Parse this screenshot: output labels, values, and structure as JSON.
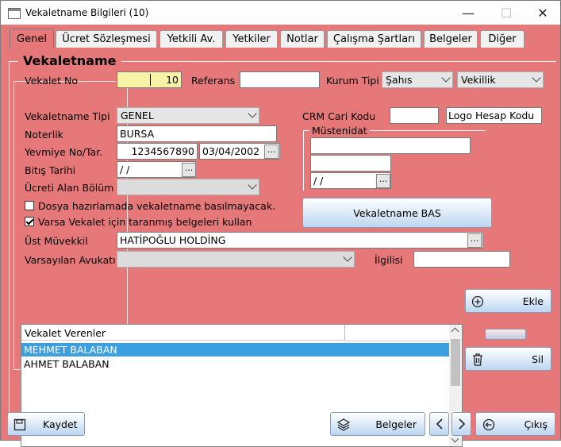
{
  "window": {
    "title": "Vekaletname Bilgileri (10)",
    "minimize": "—",
    "maximize": "☐",
    "close": "✕"
  },
  "tabs": [
    "Genel",
    "Ücret Sözleşmesi",
    "Yetkili Av.",
    "Yetkiler",
    "Notlar",
    "Çalışma Şartları",
    "Belgeler",
    "Diğer"
  ],
  "section_title": "Vekaletname",
  "form": {
    "vekalet_no_label": "Vekalet No",
    "vekalet_no": "10",
    "referans_label": "Referans",
    "referans": "",
    "kurum_tipi_label": "Kurum Tipi",
    "kurum_tipi": "Şahıs",
    "kurum_tipi2": "Vekillik",
    "vekaletname_tipi_label": "Vekaletname Tipi",
    "vekaletname_tipi": "GENEL",
    "noterlik_label": "Noterlik",
    "noterlik": "BURSA",
    "yevmiye_label": "Yevmiye No/Tar.",
    "yevmiye_no": "1234567890",
    "yevmiye_tarih": "03/04/2002",
    "bitis_label": "Bitış Tarihi",
    "bitis": " /  /",
    "ucreti_alan_label": "Ücreti Alan Bölüm",
    "ucreti_alan": "",
    "chk1_label": "Dosya hazırlamada vekaletname basılmayacak.",
    "chk2_label": "Varsa Vekalet için taranmış belgeleri kullan",
    "ust_muvekkil_label": "Üst Müvekkil",
    "ust_muvekkil": "HATİPOĞLU HOLDİNG",
    "varsayilan_avukat_label": "Varsayılan Avukatı",
    "varsayilan_avukat": "",
    "ilgilisi_label": "İlgilisi",
    "ilgilisi": "",
    "crm_label": "CRM Cari Kodu",
    "crm": "",
    "logo_button": "Logo Hesap Kodu",
    "mustenidat_label": "Müstenidat",
    "mustenidat_date": " /  /",
    "bas_button": "Vekaletname BAS"
  },
  "list": {
    "header": "Vekalet Verenler",
    "rows": [
      "MEHMET BALABAN",
      "AHMET BALABAN"
    ]
  },
  "side_buttons": {
    "ekle": "Ekle",
    "sil": "Sil"
  },
  "footer": {
    "kaydet": "Kaydet",
    "belgeler": "Belgeler",
    "cikis": "Çıkış"
  },
  "colors": {
    "panel": "#e7787a",
    "selected_row": "#3ca0e0",
    "button_top": "#ffffff",
    "button_bottom": "#bcd6f1"
  }
}
